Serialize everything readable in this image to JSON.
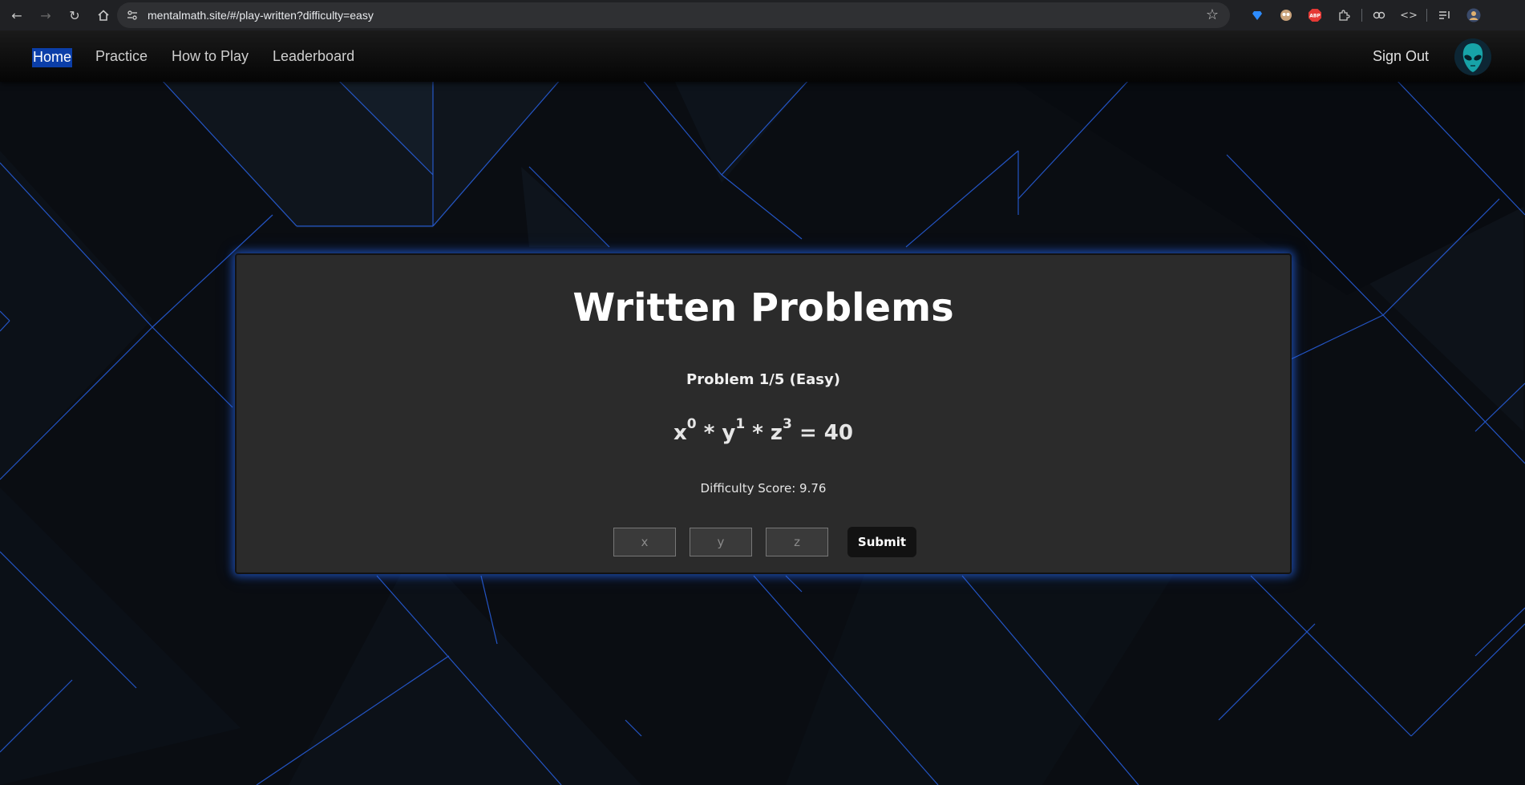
{
  "browser": {
    "url": "mentalmath.site/#/play-written?difficulty=easy",
    "extensions": [
      "gem-extension-icon",
      "owl-extension-icon",
      "adblock-icon",
      "puzzle-icon",
      "key-icon",
      "code-icon",
      "media-queue-icon",
      "profile-icon"
    ],
    "adblock_label": "ABP"
  },
  "navbar": {
    "links": [
      {
        "label": "Home",
        "active": true
      },
      {
        "label": "Practice"
      },
      {
        "label": "How to Play"
      },
      {
        "label": "Leaderboard"
      }
    ],
    "signout_label": "Sign Out"
  },
  "card": {
    "title": "Written Problems",
    "problem_label": "Problem 1/5 (Easy)",
    "equation": {
      "terms": [
        {
          "var": "x",
          "exp": "0"
        },
        {
          "var": "y",
          "exp": "1"
        },
        {
          "var": "z",
          "exp": "3"
        }
      ],
      "operator": "*",
      "rhs": "= 40"
    },
    "difficulty_score": "Difficulty Score: 9.76",
    "inputs": [
      {
        "placeholder": "x"
      },
      {
        "placeholder": "y"
      },
      {
        "placeholder": "z"
      }
    ],
    "submit_label": "Submit"
  },
  "colors": {
    "accent_glow": "#2f6bff",
    "active_link_bg": "#0b3ea8",
    "card_bg": "#2b2b2b"
  }
}
